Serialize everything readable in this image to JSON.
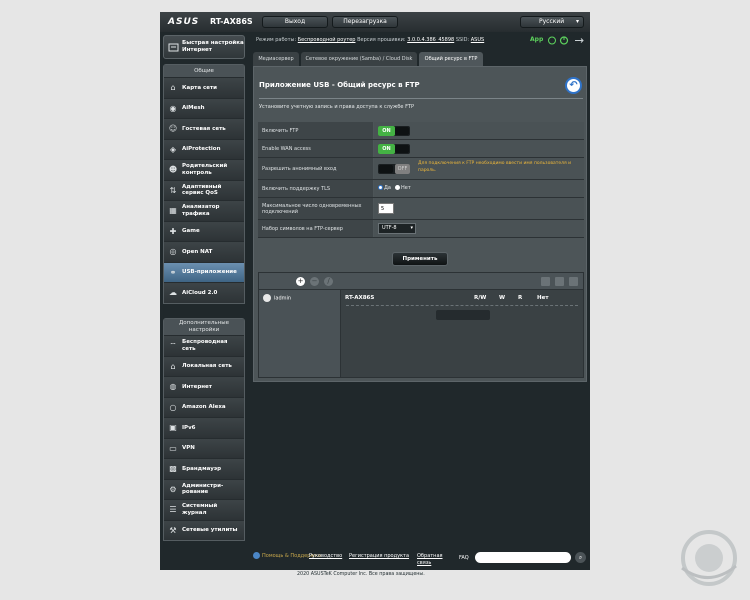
{
  "header": {
    "logo": "ASUS",
    "model": "RT-AX86S",
    "logout": "Выход",
    "reboot": "Перезагрузка",
    "language": "Русский",
    "lang_flag": "russia-flag-icon"
  },
  "info": {
    "mode_label": "Режим работы:",
    "mode_value": "Беспроводной роутер",
    "fw_label": "Версия прошивки:",
    "fw_value": "3.0.0.4.386_45898",
    "ssid_label": "SSID:",
    "ssid_value": "ASUS",
    "app_label": "App"
  },
  "tabs": [
    {
      "label": "Медиасервер"
    },
    {
      "label": "Сетевое окружение (Samba) / Cloud Disk"
    },
    {
      "label": "Общий ресурс в FTP"
    }
  ],
  "sidebar": {
    "quick_setup": "Быстрая настройка Интернет",
    "general_title": "Общие",
    "general": [
      {
        "label": "Карта сети",
        "icon": "network-map-icon"
      },
      {
        "label": "AiMesh",
        "icon": "aimesh-icon"
      },
      {
        "label": "Гостевая сеть",
        "icon": "guest-network-icon"
      },
      {
        "label": "AiProtection",
        "icon": "shield-icon"
      },
      {
        "label": "Родительский контроль",
        "icon": "parental-control-icon"
      },
      {
        "label": "Адаптивный сервис QoS",
        "icon": "qos-icon"
      },
      {
        "label": "Анализатор трафика",
        "icon": "traffic-analyzer-icon"
      },
      {
        "label": "Game",
        "icon": "gamepad-icon"
      },
      {
        "label": "Open NAT",
        "icon": "open-nat-icon"
      },
      {
        "label": "USB-приложение",
        "icon": "usb-icon"
      },
      {
        "label": "AiCloud 2.0",
        "icon": "cloud-icon"
      }
    ],
    "advanced_title": "Дополнительные настройки",
    "advanced": [
      {
        "label": "Беспроводная сеть",
        "icon": "wireless-icon"
      },
      {
        "label": "Локальная сеть",
        "icon": "lan-icon"
      },
      {
        "label": "Интернет",
        "icon": "globe-icon"
      },
      {
        "label": "Amazon Alexa",
        "icon": "alexa-icon"
      },
      {
        "label": "IPv6",
        "icon": "ipv6-icon"
      },
      {
        "label": "VPN",
        "icon": "vpn-icon"
      },
      {
        "label": "Брандмауэр",
        "icon": "firewall-icon"
      },
      {
        "label": "Администри-рование",
        "icon": "admin-icon"
      },
      {
        "label": "Системный журнал",
        "icon": "system-log-icon"
      },
      {
        "label": "Сетевые утилиты",
        "icon": "network-tools-icon"
      }
    ]
  },
  "panel": {
    "title": "Приложение USB - Общий ресурс в FTP",
    "description": "Установите учетную запись и права доступа к службе FTP",
    "rows": {
      "enable_ftp": {
        "label": "Включить FTP",
        "value": "ON"
      },
      "enable_wan": {
        "label": "Enable WAN access",
        "value": "ON"
      },
      "anon": {
        "label": "Разрешить анонимный вход",
        "value": "OFF",
        "warning": "Для подключения к FTP необходимо ввести имя пользователя и пароль."
      },
      "tls": {
        "label": "Включить поддержку TLS",
        "yes": "Да",
        "no": "Нет",
        "selected": "Да"
      },
      "max_conn": {
        "label": "Максимальное число одновременных подключений",
        "value": "5"
      },
      "charset": {
        "label": "Набор символов на FTP-сервер",
        "value": "UTF-8"
      }
    },
    "apply": "Применить",
    "fileshare": {
      "user": "ladmin",
      "device": "RT-AX86S",
      "cols": [
        "R/W",
        "W",
        "R",
        "Нет"
      ]
    }
  },
  "footer": {
    "help": "Помощь & Поддержка",
    "manual": "Руководство",
    "register": "Регистрация продукта",
    "feedback": "Обратная связь",
    "faq": "FAQ",
    "copyright": "2020 ASUSTeK Computer Inc. Все права защищены."
  },
  "colors": {
    "background": "#20282b",
    "selected_nav": "#4f7aa0",
    "toggle_on": "#44b244",
    "warning": "#f0b93a"
  }
}
